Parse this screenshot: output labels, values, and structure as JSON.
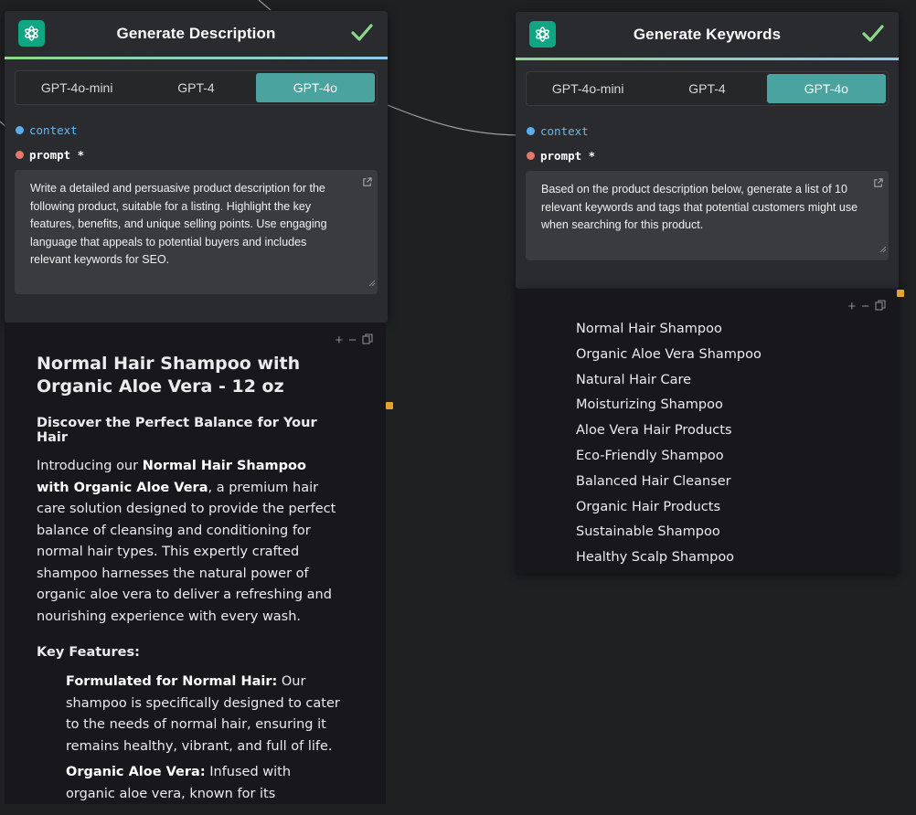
{
  "nodes": [
    {
      "title": "Generate Description",
      "tabs": [
        "GPT-4o-mini",
        "GPT-4",
        "GPT-4o"
      ],
      "active_tab": "GPT-4o",
      "ports": {
        "context": "context",
        "prompt": "prompt *"
      },
      "prompt": "Write a detailed and persuasive product description for the following product, suitable for a listing. Highlight the key features, benefits, and unique selling points. Use engaging language that appeals to potential buyers and includes relevant keywords for SEO.",
      "output": {
        "heading": "Normal Hair Shampoo with Organic Aloe Vera - 12 oz",
        "subheading": "Discover the Perfect Balance for Your Hair",
        "intro_prefix": "Introducing our ",
        "intro_bold": "Normal Hair Shampoo with Organic Aloe Vera",
        "intro_suffix": ", a premium hair care solution designed to provide the perfect balance of cleansing and conditioning for normal hair types. This expertly crafted shampoo harnesses the natural power of organic aloe vera to deliver a refreshing and nourishing experience with every wash.",
        "features_heading": "Key Features:",
        "features": [
          {
            "title": "Formulated for Normal Hair:",
            "text": " Our shampoo is specifically designed to cater to the needs of normal hair, ensuring it remains healthy, vibrant, and full of life."
          },
          {
            "title": "Organic Aloe Vera:",
            "text": " Infused with organic aloe vera, known for its exceptional"
          }
        ]
      }
    },
    {
      "title": "Generate Keywords",
      "tabs": [
        "GPT-4o-mini",
        "GPT-4",
        "GPT-4o"
      ],
      "active_tab": "GPT-4o",
      "ports": {
        "context": "context",
        "prompt": "prompt *"
      },
      "prompt": "Based on the product description below, generate a list of 10 relevant keywords and tags that potential customers might use when searching for this product.",
      "output": {
        "keywords": [
          "Normal Hair Shampoo",
          "Organic Aloe Vera Shampoo",
          "Natural Hair Care",
          "Moisturizing Shampoo",
          "Aloe Vera Hair Products",
          "Eco-Friendly Shampoo",
          "Balanced Hair Cleanser",
          "Organic Hair Products",
          "Sustainable Shampoo",
          "Healthy Scalp Shampoo"
        ]
      }
    }
  ],
  "icons": {
    "logo": "openai-logo-icon",
    "status": "check-icon",
    "open_external": "external-link-icon",
    "tools": [
      "plus-icon",
      "minus-icon",
      "copy-icon"
    ]
  },
  "colors": {
    "accent_tab": "#4aa39f",
    "logo_bg": "#11a683",
    "check": "#8cd88c",
    "context_port": "#5aaef0",
    "prompt_port": "#e2796a",
    "output_port": "#e3a233"
  }
}
